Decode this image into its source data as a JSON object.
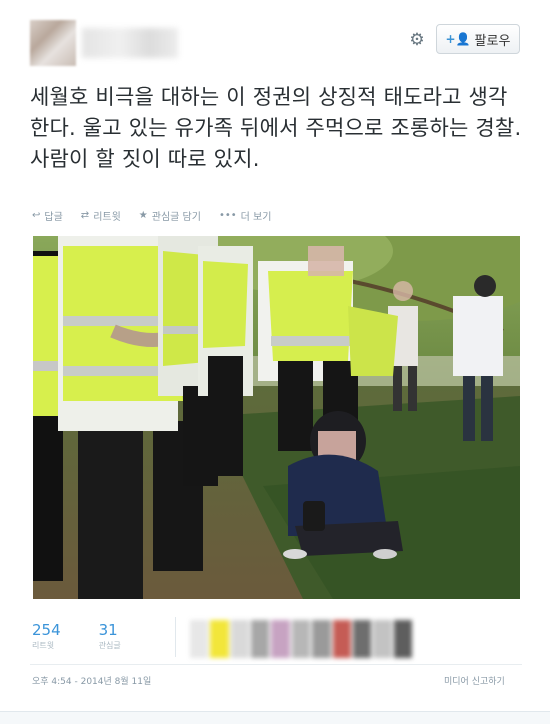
{
  "header": {
    "follow_label": "팔로우",
    "follow_icon": "follow-user-icon",
    "settings_icon": "gear-icon"
  },
  "tweet": {
    "text": "세월호 비극을 대하는 이 정권의 상징적 태도라고 생각한다. 울고 있는 유가족 뒤에서 주먹으로 조롱하는 경찰. 사람이 할 짓이 따로 있지."
  },
  "actions": [
    {
      "icon": "reply-icon",
      "label": "답글"
    },
    {
      "icon": "retweet-icon",
      "label": "리트윗"
    },
    {
      "icon": "star-icon",
      "label": "관심글 담기"
    },
    {
      "icon": "more-icon",
      "label": "더 보기"
    }
  ],
  "stats": {
    "retweets": {
      "value": "254",
      "label": "리트윗"
    },
    "favorites": {
      "value": "31",
      "label": "관심글"
    }
  },
  "meta": {
    "timestamp": "오후 4:54 - 2014년 8월 11일",
    "report_label": "미디어 신고하기"
  },
  "colors": {
    "accent": "#3b94d9",
    "muted": "#8899a6",
    "vest": "#d4ef4f"
  }
}
